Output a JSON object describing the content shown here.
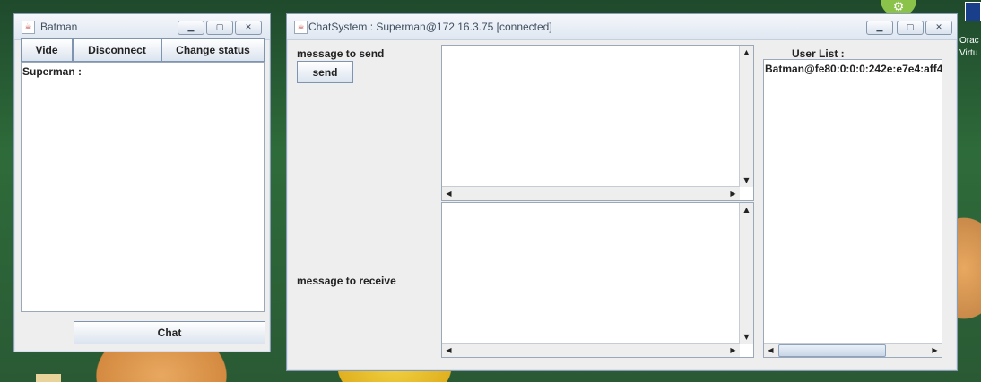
{
  "batman_window": {
    "title": "Batman",
    "buttons": [
      "Vide",
      "Disconnect",
      "Change status"
    ],
    "chat_area_text": "Superman :",
    "chat_button": "Chat"
  },
  "chat_window": {
    "title": "ChatSystem : Superman@172.16.3.75 [connected]",
    "send_label": "message to send",
    "send_button": "send",
    "receive_label": "message to receive",
    "user_list_label": "User List :",
    "users": [
      "Batman@fe80:0:0:0:242e:e7e4:aff4"
    ]
  },
  "desktop": {
    "icon_label_1": "Orac",
    "icon_label_2": "Virtu"
  }
}
